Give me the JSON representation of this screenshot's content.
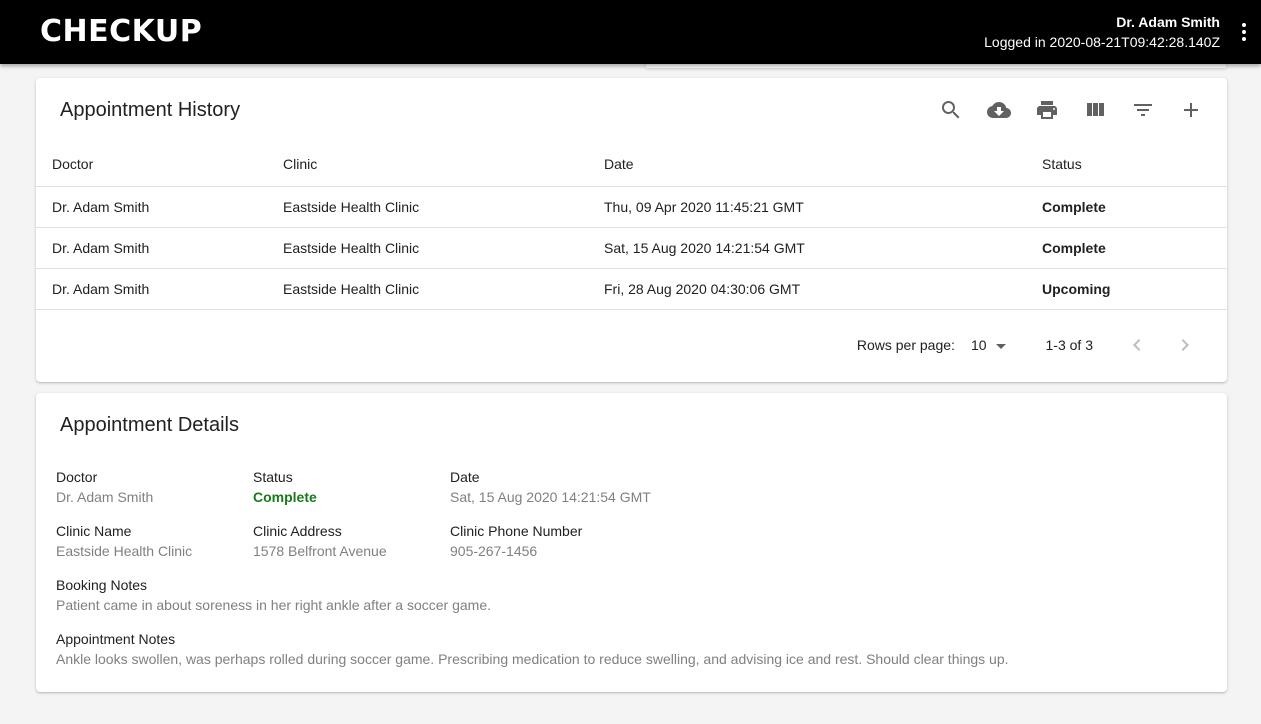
{
  "header": {
    "brand": "CHECKUP",
    "user_name": "Dr. Adam Smith",
    "login_text": "Logged in 2020-08-21T09:42:28.140Z"
  },
  "history": {
    "title": "Appointment History",
    "toolbar_icons": [
      "search-icon",
      "download-icon",
      "print-icon",
      "view-columns-icon",
      "filter-icon",
      "add-icon"
    ],
    "columns": [
      "Doctor",
      "Clinic",
      "Date",
      "Status"
    ],
    "rows": [
      {
        "doctor": "Dr. Adam Smith",
        "clinic": "Eastside Health Clinic",
        "date": "Thu, 09 Apr 2020 11:45:21 GMT",
        "status": "Complete"
      },
      {
        "doctor": "Dr. Adam Smith",
        "clinic": "Eastside Health Clinic",
        "date": "Sat, 15 Aug 2020 14:21:54 GMT",
        "status": "Complete"
      },
      {
        "doctor": "Dr. Adam Smith",
        "clinic": "Eastside Health Clinic",
        "date": "Fri, 28 Aug 2020 04:30:06 GMT",
        "status": "Upcoming"
      }
    ],
    "pagination": {
      "rows_per_page_label": "Rows per page:",
      "rows_per_page": "10",
      "range": "1-3 of 3"
    }
  },
  "details": {
    "title": "Appointment Details",
    "doctor_label": "Doctor",
    "doctor": "Dr. Adam Smith",
    "status_label": "Status",
    "status": "Complete",
    "date_label": "Date",
    "date": "Sat, 15 Aug 2020 14:21:54 GMT",
    "clinic_name_label": "Clinic Name",
    "clinic_name": "Eastside Health Clinic",
    "clinic_address_label": "Clinic Address",
    "clinic_address": "1578 Belfront Avenue",
    "clinic_phone_label": "Clinic Phone Number",
    "clinic_phone": "905-267-1456",
    "booking_notes_label": "Booking Notes",
    "booking_notes": "Patient came in about soreness in her right ankle after a soccer game.",
    "appointment_notes_label": "Appointment Notes",
    "appointment_notes": "Ankle looks swollen, was perhaps rolled during soccer game. Prescribing medication to reduce swelling, and advising ice and rest. Should clear things up."
  },
  "colors": {
    "header_bg": "#000000",
    "status_complete": "#1b7a1b",
    "status_upcoming": "#f5a623"
  }
}
